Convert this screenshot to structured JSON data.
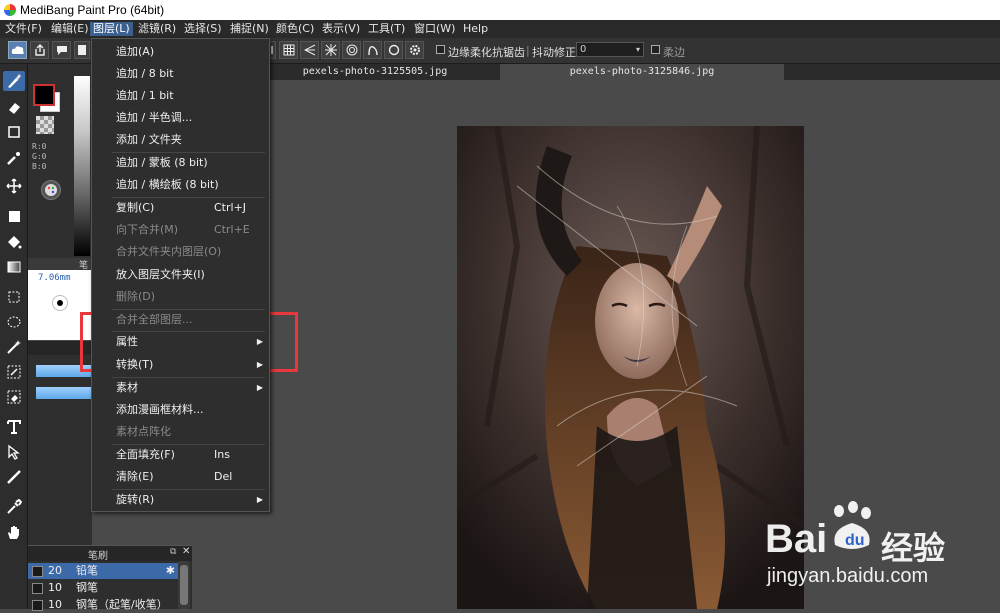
{
  "window": {
    "title": "MediBang Paint Pro (64bit)"
  },
  "menubar": [
    {
      "label": "文件(F)"
    },
    {
      "label": "编辑(E)"
    },
    {
      "label": "图层(L)"
    },
    {
      "label": "滤镜(R)"
    },
    {
      "label": "选择(S)"
    },
    {
      "label": "捕捉(N)"
    },
    {
      "label": "颜色(C)"
    },
    {
      "label": "表示(V)"
    },
    {
      "label": "工具(T)"
    },
    {
      "label": "窗口(W)"
    },
    {
      "label": "Help"
    }
  ],
  "layer_menu": {
    "items": [
      {
        "label": "追加(A)",
        "shortcut": "",
        "disabled": false
      },
      {
        "label": "追加 / 8 bit",
        "shortcut": "",
        "disabled": false
      },
      {
        "label": "追加 / 1 bit",
        "shortcut": "",
        "disabled": false
      },
      {
        "label": "追加 / 半色调...",
        "shortcut": "",
        "disabled": false
      },
      {
        "label": "添加 / 文件夹",
        "shortcut": "",
        "disabled": false
      },
      {
        "label": "追加 / 蒙板 (8 bit)",
        "shortcut": "",
        "disabled": false
      },
      {
        "label": "追加 / 横绘板 (8 bit)",
        "shortcut": "",
        "disabled": false
      },
      {
        "label": "复制(C)",
        "shortcut": "Ctrl+J",
        "disabled": false
      },
      {
        "label": "向下合并(M)",
        "shortcut": "Ctrl+E",
        "disabled": true
      },
      {
        "label": "合并文件夹内图层(O)",
        "shortcut": "",
        "disabled": true
      },
      {
        "label": "放入图层文件夹(I)",
        "shortcut": "",
        "disabled": false
      },
      {
        "label": "删除(D)",
        "shortcut": "",
        "disabled": true
      },
      {
        "label": "合并全部图层...",
        "shortcut": "",
        "disabled": true
      },
      {
        "label": "属性",
        "shortcut": "",
        "disabled": false,
        "submenu": true
      },
      {
        "label": "转换(T)",
        "shortcut": "",
        "disabled": false,
        "submenu": true
      },
      {
        "label": "素材",
        "shortcut": "",
        "disabled": false,
        "submenu": true
      },
      {
        "label": "添加漫画框材料...",
        "shortcut": "",
        "disabled": false
      },
      {
        "label": "素材点阵化",
        "shortcut": "",
        "disabled": true
      },
      {
        "label": "全面填充(F)",
        "shortcut": "Ins",
        "disabled": false
      },
      {
        "label": "清除(E)",
        "shortcut": "Del",
        "disabled": false
      },
      {
        "label": "旋转(R)",
        "shortcut": "",
        "disabled": false,
        "submenu": true
      }
    ]
  },
  "toolbar": {
    "antialias_label": "边缘柔化抗锯齿",
    "stabilizer_label": "抖动修正",
    "stabilizer_value": "0",
    "soft_label": "柔边"
  },
  "tabs": [
    {
      "label": "pexels-photo-3125505.jpg",
      "active": false
    },
    {
      "label": "pexels-photo-3125846.jpg",
      "active": true
    }
  ],
  "color_panel": {
    "r": "R:0",
    "g": "G:0",
    "b": "B:0",
    "foreground": "#000000",
    "background": "#ffffff"
  },
  "brush_size_panel": {
    "header": "笔",
    "size": "7.06mm"
  },
  "brush_panel": {
    "title": "笔刷",
    "brushes": [
      {
        "size": "20",
        "name": "铅笔",
        "selected": true
      },
      {
        "size": "10",
        "name": "钢笔",
        "selected": false
      },
      {
        "size": "10",
        "name": "钢笔（起笔/收笔）",
        "selected": false
      }
    ]
  },
  "watermark": {
    "brand_latin": "Bai",
    "brand_cn": "经验",
    "url": "jingyan.baidu.com"
  },
  "colors": {
    "accent": "#3c6aa8",
    "highlight": "#e8383b"
  }
}
